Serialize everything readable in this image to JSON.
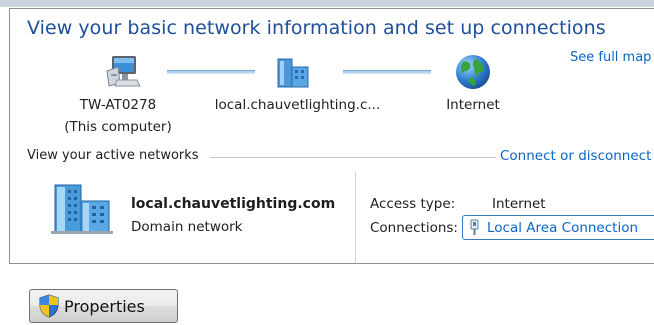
{
  "heading": "View your basic network information and set up connections",
  "see_full_map": "See full map",
  "map": {
    "computer": {
      "name": "TW-AT0278",
      "sublabel": "(This computer)",
      "icon": "computer-icon"
    },
    "domain": {
      "name": "local.chauvetlighting.c...",
      "icon": "domain-network-icon"
    },
    "internet": {
      "name": "Internet",
      "icon": "globe-icon"
    }
  },
  "active_networks_label": "View your active networks",
  "connect_or_disconnect": "Connect or disconnect",
  "active_network": {
    "name": "local.chauvetlighting.com",
    "type": "Domain network",
    "icon": "domain-buildings-icon",
    "access_type_label": "Access type:",
    "access_type_value": "Internet",
    "connections_label": "Connections:",
    "connection_name": "Local Area Connection",
    "connection_icon": "network-plug-icon"
  },
  "properties_button": {
    "label": "Properties",
    "icon": "uac-shield-icon"
  },
  "colors": {
    "heading": "#1f4e9c",
    "link": "#0a64c8",
    "focus_border": "#3a78c4"
  }
}
